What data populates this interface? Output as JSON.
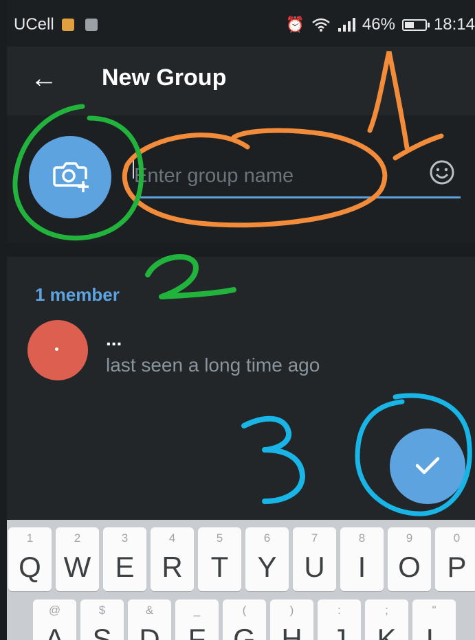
{
  "status_bar": {
    "carrier": "UCell",
    "alarm_icon": "alarm-clock-icon",
    "wifi_icon": "wifi-icon",
    "signal_icon": "signal-bars-icon",
    "battery_percent": "46%",
    "time": "18:14"
  },
  "app_bar": {
    "back_icon": "arrow-left-icon",
    "title": "New Group"
  },
  "group_info": {
    "camera_icon": "camera-add-icon",
    "name_placeholder": "Enter group name",
    "emoji_icon": "smiley-icon"
  },
  "members": {
    "header": "1 member",
    "list": [
      {
        "name": "...",
        "status": "last seen a long time ago",
        "avatar_color": "#dc5f50"
      }
    ]
  },
  "fab": {
    "icon": "checkmark-icon"
  },
  "annotations": {
    "label_1": "1",
    "label_2": "2",
    "label_3": "3",
    "colors": {
      "orange": "#f28c3a",
      "green": "#22b33c",
      "cyan": "#19b5e6"
    }
  },
  "keyboard": {
    "row1": [
      {
        "hint": "1",
        "key": "Q"
      },
      {
        "hint": "2",
        "key": "W"
      },
      {
        "hint": "3",
        "key": "E"
      },
      {
        "hint": "4",
        "key": "R"
      },
      {
        "hint": "5",
        "key": "T"
      },
      {
        "hint": "6",
        "key": "Y"
      },
      {
        "hint": "7",
        "key": "U"
      },
      {
        "hint": "8",
        "key": "I"
      },
      {
        "hint": "9",
        "key": "O"
      },
      {
        "hint": "0",
        "key": "P"
      }
    ],
    "row2": [
      {
        "hint": "@",
        "key": "A"
      },
      {
        "hint": "$",
        "key": "S"
      },
      {
        "hint": "&",
        "key": "D"
      },
      {
        "hint": "_",
        "key": "F"
      },
      {
        "hint": "(",
        "key": "G"
      },
      {
        "hint": ")",
        "key": "H"
      },
      {
        "hint": ":",
        "key": "J"
      },
      {
        "hint": ";",
        "key": "K"
      },
      {
        "hint": "\"",
        "key": "L"
      }
    ]
  },
  "colors": {
    "accent": "#5da3e0",
    "background": "#222629",
    "app_bar": "#232729"
  }
}
